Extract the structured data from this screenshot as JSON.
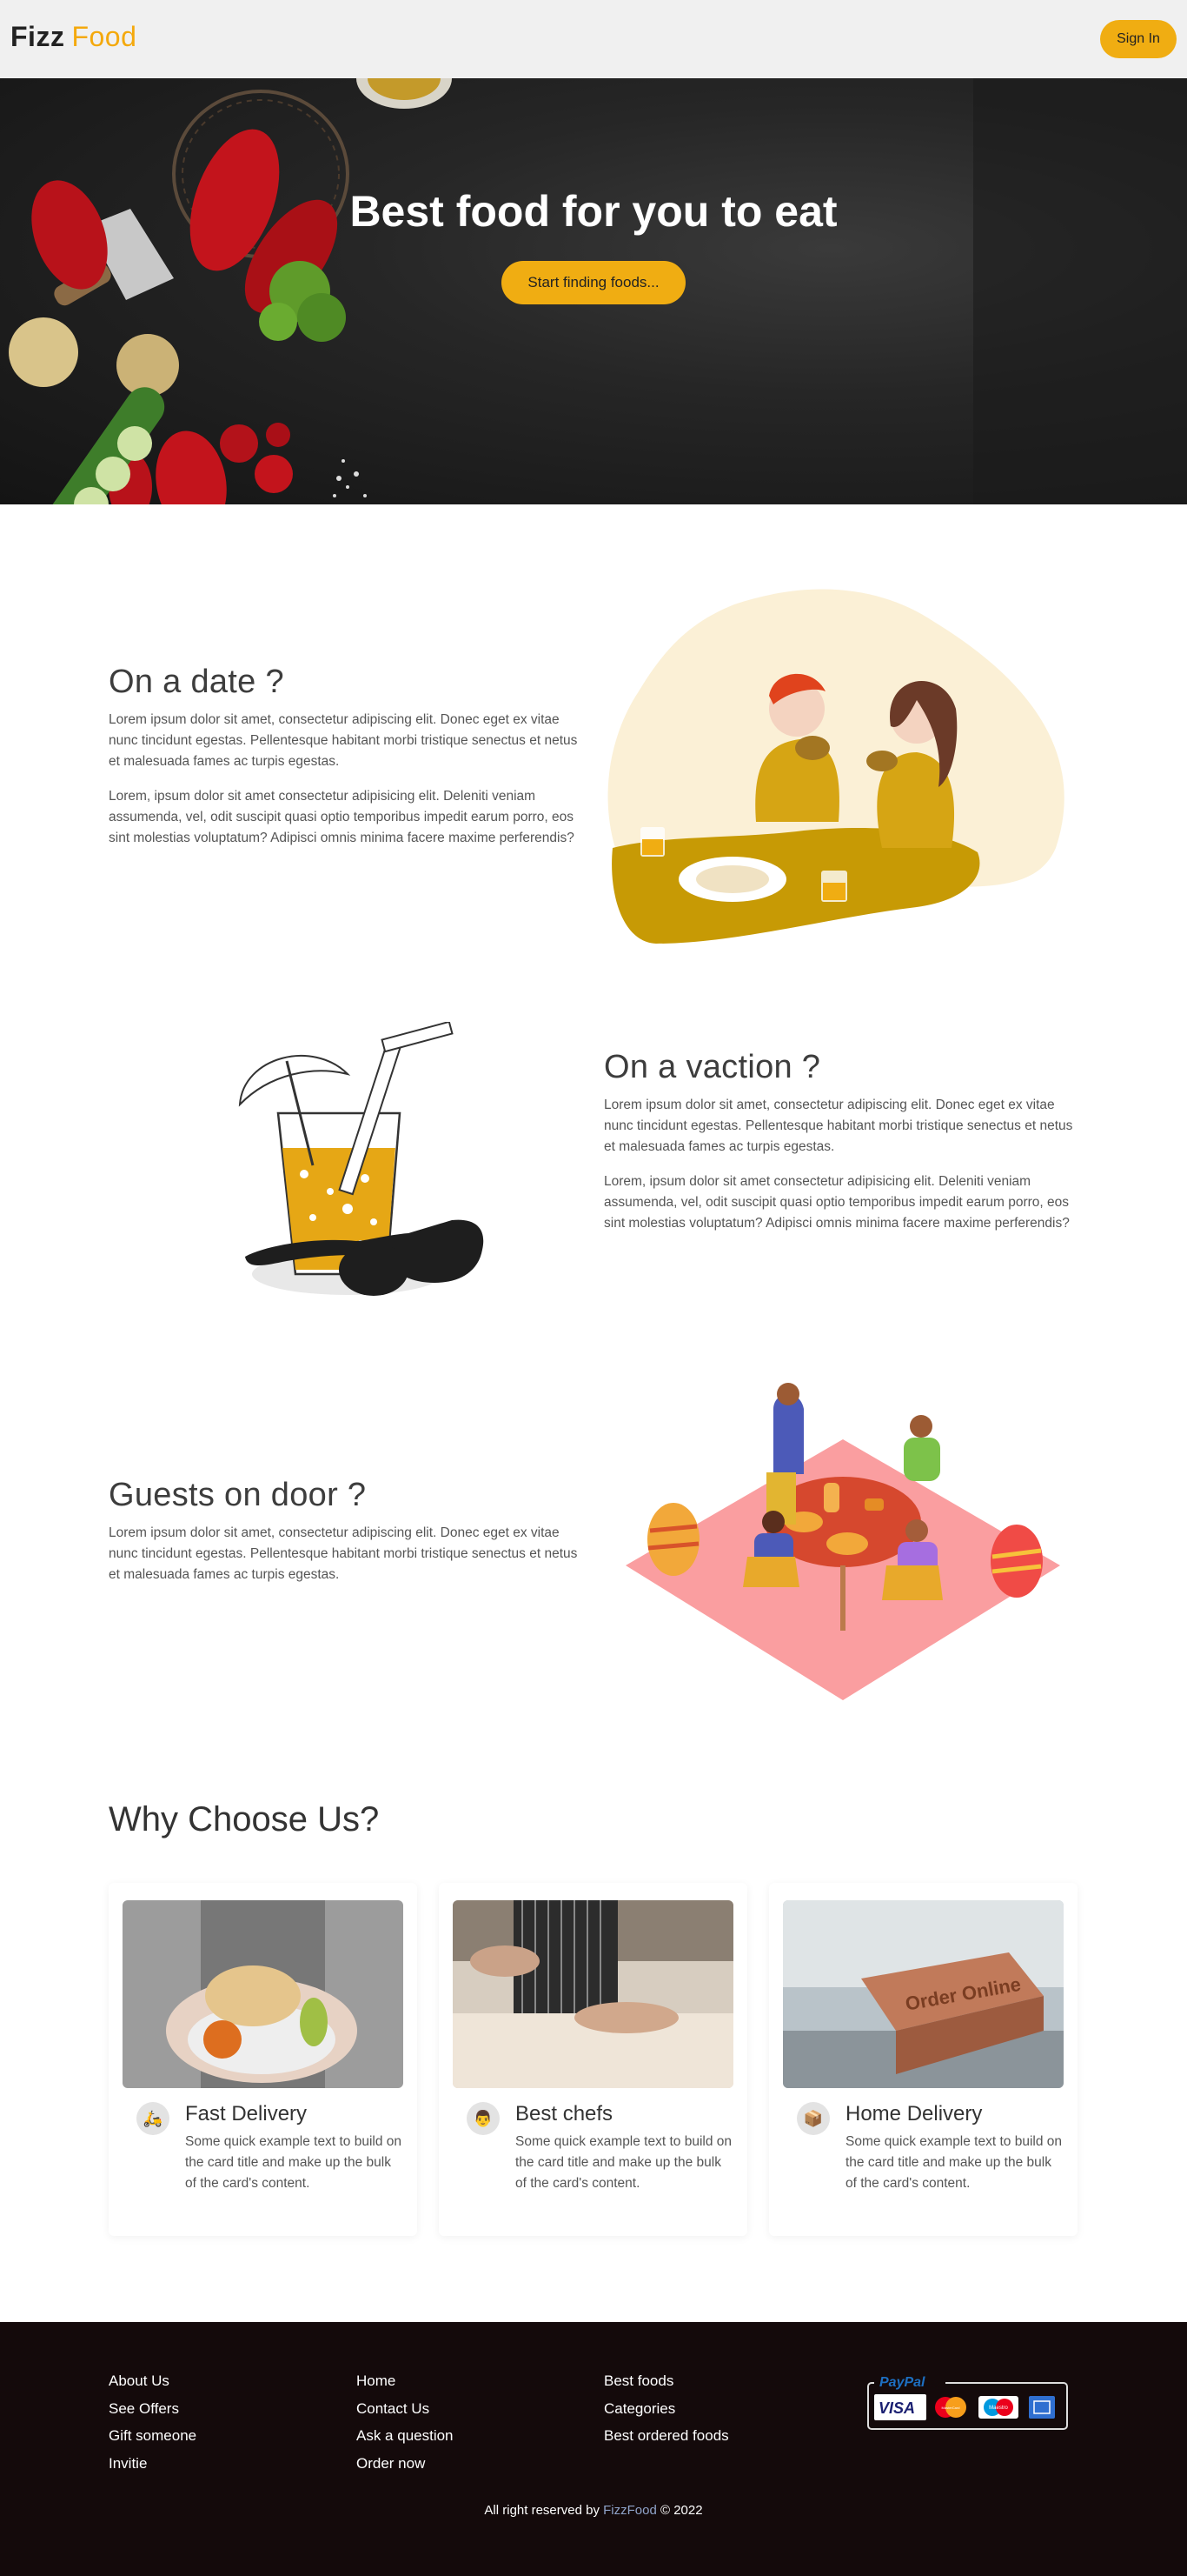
{
  "navbar": {
    "brand_part1": "Fizz",
    "brand_part2": "Food",
    "signin_label": "Sign In"
  },
  "hero": {
    "title": "Best food for you to eat",
    "button_label": "Start finding foods..."
  },
  "features": [
    {
      "title": "On a date ?",
      "paragraphs": [
        "Lorem ipsum dolor sit amet, consectetur adipiscing elit. Donec eget ex vitae nunc tincidunt egestas. Pellentesque habitant morbi tristique senectus et netus et malesuada fames ac turpis egestas.",
        "Lorem, ipsum dolor sit amet consectetur adipisicing elit. Deleniti veniam assumenda, vel, odit suscipit quasi optio temporibus impedit earum porro, eos sint molestias voluptatum? Adipisci omnis minima facere maxime perferendis?"
      ]
    },
    {
      "title": "On a vaction ?",
      "paragraphs": [
        "Lorem ipsum dolor sit amet, consectetur adipiscing elit. Donec eget ex vitae nunc tincidunt egestas. Pellentesque habitant morbi tristique senectus et netus et malesuada fames ac turpis egestas.",
        "Lorem, ipsum dolor sit amet consectetur adipisicing elit. Deleniti veniam assumenda, vel, odit suscipit quasi optio temporibus impedit earum porro, eos sint molestias voluptatum? Adipisci omnis minima facere maxime perferendis?"
      ]
    },
    {
      "title": "Guests on door ?",
      "paragraphs": [
        "Lorem ipsum dolor sit amet, consectetur adipiscing elit. Donec eget ex vitae nunc tincidunt egestas. Pellentesque habitant morbi tristique senectus et netus et malesuada fames ac turpis egestas."
      ]
    }
  ],
  "why": {
    "title": "Why Choose Us?",
    "cards": [
      {
        "title": "Fast Delivery",
        "text": "Some quick example text to build on the card title and make up the bulk of the card's content."
      },
      {
        "title": "Best chefs",
        "text": "Some quick example text to build on the card title and make up the bulk of the card's content."
      },
      {
        "title": "Home Delivery",
        "text": "Some quick example text to build on the card title and make up the bulk of the card's content.",
        "image_caption": "Order Online"
      }
    ]
  },
  "footer": {
    "col1": [
      "About Us",
      "See Offers",
      "Gift someone",
      "Invitie"
    ],
    "col2": [
      "Home",
      "Contact Us",
      "Ask a question",
      "Order now"
    ],
    "col3": [
      "Best foods",
      "Categories",
      "Best ordered foods"
    ],
    "payment": {
      "paypal": "PayPal",
      "visa": "VISA",
      "mastercard": "MasterCard",
      "maestro": "Maestro"
    },
    "copyright_prefix": "All right reserved by",
    "copyright_brand": "FizzFood",
    "copyright_suffix": "© 2022"
  },
  "colors": {
    "accent": "#f0ad12",
    "footer_bg": "#140a0b",
    "navbar_bg": "#f0f0f0"
  }
}
